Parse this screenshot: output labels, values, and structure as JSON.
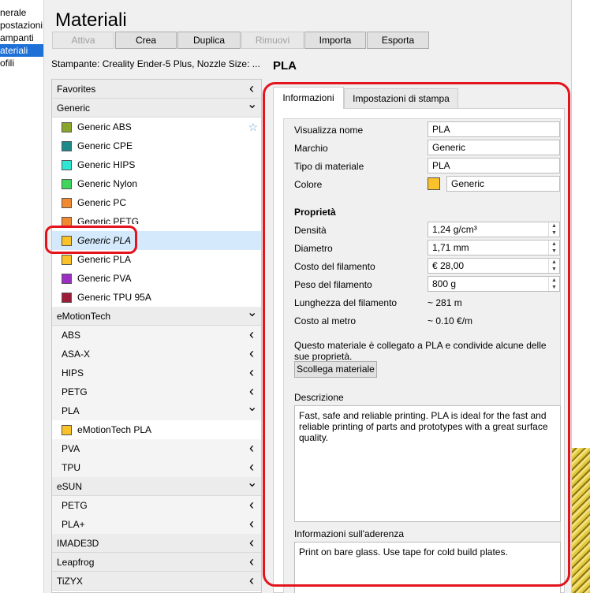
{
  "sidebar": {
    "items": [
      {
        "label": "nerale",
        "selected": false
      },
      {
        "label": "postazioni",
        "selected": false
      },
      {
        "label": "ampanti",
        "selected": false
      },
      {
        "label": "ateriali",
        "selected": true
      },
      {
        "label": "ofili",
        "selected": false
      }
    ]
  },
  "page": {
    "title": "Materiali",
    "printer_info": "Stampante: Creality Ender-5 Plus, Nozzle Size: ...",
    "material_name": "PLA"
  },
  "toolbar": {
    "activate": "Attiva",
    "create": "Crea",
    "duplicate": "Duplica",
    "remove": "Rimuovi",
    "import": "Importa",
    "export": "Esporta"
  },
  "materials_list": {
    "rows": [
      {
        "kind": "header",
        "label": "Favorites",
        "chevron": "left"
      },
      {
        "kind": "header",
        "label": "Generic",
        "chevron": "down"
      },
      {
        "kind": "material",
        "label": "Generic ABS",
        "color": "#8aa52a",
        "star": true
      },
      {
        "kind": "material",
        "label": "Generic CPE",
        "color": "#1f8a8a"
      },
      {
        "kind": "material",
        "label": "Generic HIPS",
        "color": "#2ee6d3"
      },
      {
        "kind": "material",
        "label": "Generic Nylon",
        "color": "#3fd45a"
      },
      {
        "kind": "material",
        "label": "Generic PC",
        "color": "#f08a30"
      },
      {
        "kind": "material",
        "label": "Generic PETG",
        "color": "#f08a30",
        "clipped": true
      },
      {
        "kind": "material",
        "label": "Generic PLA",
        "color": "#fac22a",
        "selected": true
      },
      {
        "kind": "material",
        "label": "Generic PLA",
        "color": "#fac22a"
      },
      {
        "kind": "material",
        "label": "Generic PVA",
        "color": "#9b2fc4"
      },
      {
        "kind": "material",
        "label": "Generic TPU 95A",
        "color": "#9c1c3a"
      },
      {
        "kind": "header",
        "label": "eMotionTech",
        "chevron": "down"
      },
      {
        "kind": "type",
        "label": "ABS",
        "chevron": "left"
      },
      {
        "kind": "type",
        "label": "ASA-X",
        "chevron": "left"
      },
      {
        "kind": "type",
        "label": "HIPS",
        "chevron": "left"
      },
      {
        "kind": "type",
        "label": "PETG",
        "chevron": "left"
      },
      {
        "kind": "type",
        "label": "PLA",
        "chevron": "down"
      },
      {
        "kind": "material",
        "label": "eMotionTech PLA",
        "color": "#fac22a"
      },
      {
        "kind": "type",
        "label": "PVA",
        "chevron": "left"
      },
      {
        "kind": "type",
        "label": "TPU",
        "chevron": "left"
      },
      {
        "kind": "header",
        "label": "eSUN",
        "chevron": "down"
      },
      {
        "kind": "type",
        "label": "PETG",
        "chevron": "left"
      },
      {
        "kind": "type",
        "label": "PLA+",
        "chevron": "left"
      },
      {
        "kind": "header",
        "label": "IMADE3D",
        "chevron": "left"
      },
      {
        "kind": "header",
        "label": "Leapfrog",
        "chevron": "left"
      },
      {
        "kind": "header",
        "label": "TiZYX",
        "chevron": "left"
      }
    ]
  },
  "tabs": {
    "info": "Informazioni",
    "print": "Impostazioni di stampa"
  },
  "info": {
    "display_name_label": "Visualizza nome",
    "display_name": "PLA",
    "brand_label": "Marchio",
    "brand": "Generic",
    "type_label": "Tipo di materiale",
    "type": "PLA",
    "color_label": "Colore",
    "color_name": "Generic",
    "color_hex": "#fac22a",
    "properties_heading": "Proprietà",
    "density_label": "Densità",
    "density": "1,24 g/cm³",
    "diameter_label": "Diametro",
    "diameter": "1,71 mm",
    "cost_label": "Costo del filamento",
    "cost": "€ 28,00",
    "weight_label": "Peso del filamento",
    "weight": "800 g",
    "length_label": "Lunghezza del filamento",
    "length": "~ 281 m",
    "cost_per_m_label": "Costo al metro",
    "cost_per_m": "~ 0.10 €/m",
    "linked_text": "Questo materiale è collegato a PLA e condivide alcune delle sue proprietà.",
    "unlink_button": "Scollega materiale",
    "description_label": "Descrizione",
    "description": "Fast, safe and reliable printing. PLA is ideal for the fast and reliable printing of parts and prototypes with a great surface quality.",
    "adhesion_label": "Informazioni sull'aderenza",
    "adhesion": "Print on bare glass. Use tape for cold build plates."
  },
  "colors": {
    "selection_blue": "#1c70d6",
    "annotation_red": "#e3141e"
  }
}
